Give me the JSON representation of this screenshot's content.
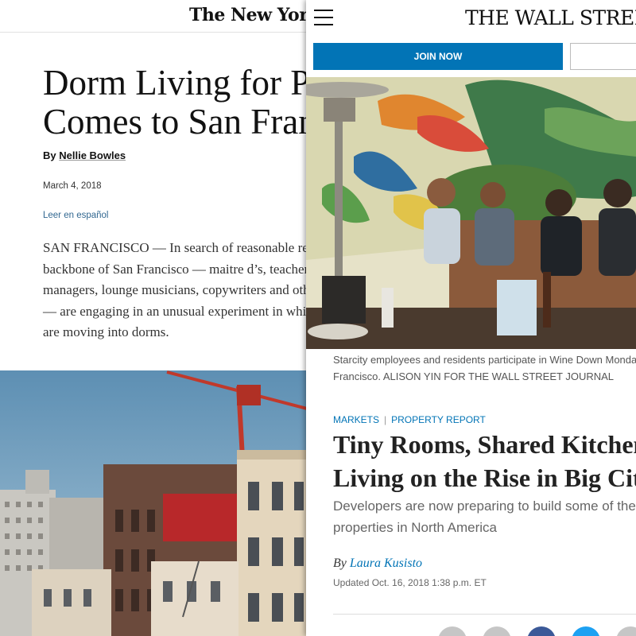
{
  "nyt": {
    "logo": "The New York Times",
    "headline_line1": "Dorm Living for Professionals",
    "headline_line2": "Comes to San Francisco",
    "byline_prefix": "By",
    "author": "Nellie Bowles",
    "date": "March 4, 2018",
    "language_link": "Leer en español",
    "body_lines": [
      "SAN FRANCISCO — In search of reasonable rent, the",
      "backbone of San Francisco — maitre d’s, teachers,",
      "managers, lounge musicians, copywriters and others",
      "— are engaging in an unusual experiment in which they",
      "are moving into dorms."
    ]
  },
  "wsj": {
    "logo": "THE WALL STREET JOURNAL.",
    "join_label": "JOIN NOW",
    "caption_line1": "Starcity employees and residents participate in Wine Down Monday in San",
    "caption_line2": "Francisco. ALISON YIN FOR THE WALL STREET JOURNAL",
    "kicker_section": "MARKETS",
    "kicker_separator": "|",
    "kicker_topic": "PROPERTY REPORT",
    "headline_line1": "Tiny Rooms, Shared Kitchens:",
    "headline_line2": "Living on the Rise in Big Cities",
    "dek_line1": "Developers are now preparing to build some of the",
    "dek_line2": "properties in North America",
    "byline_prefix": "By",
    "author": "Laura Kusisto",
    "updated": "Updated Oct. 16, 2018 1:38 p.m. ET",
    "share_colors": [
      "#c6c6c6",
      "#c6c6c6",
      "#3b5998",
      "#1da1f2",
      "#c6c6c6"
    ]
  }
}
